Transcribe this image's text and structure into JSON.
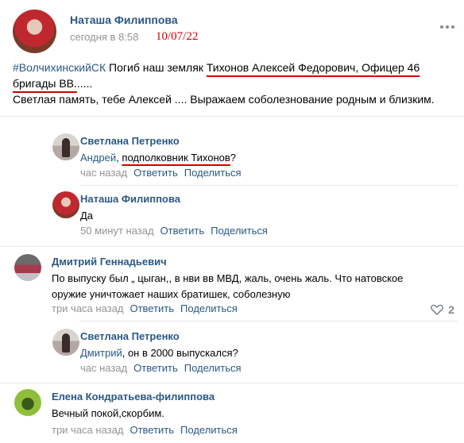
{
  "post": {
    "author": "Наташа Филиппова",
    "date": "сегодня в 8:58",
    "date_annotation": "10/07/22",
    "hashtag": "#ВолчихинскийСК",
    "text_1": " Погиб наш земляк ",
    "text_underlined_1": "Тихонов Алексей Федорович, Офицер 46",
    "text_underlined_2": "бригады ВВ.",
    "text_2": ".....",
    "text_3": "Светлая память, тебе Алексей .... Выражаем соболезнование родным и близким."
  },
  "actions": {
    "reply": "Ответить",
    "share": "Поделиться"
  },
  "comments": [
    {
      "author": "Светлана Петренко",
      "mention": "Андрей",
      "text_pre": ", ",
      "text_underlined": "подполковник Тихонов",
      "text_post": "?",
      "time": "час назад"
    },
    {
      "author": "Наташа Филиппова",
      "text": "Да",
      "time": "50 минут назад"
    },
    {
      "author": "Дмитрий Геннадьевич",
      "text_line1": "По выпуску был „ цыган,, в нви вв МВД, жаль, очень жаль. Что натовское",
      "text_line2": "оружие уничтожает наших братишек, соболезную",
      "time": "три часа назад",
      "likes": "2"
    },
    {
      "author": "Светлана Петренко",
      "mention": "Дмитрий",
      "text": ", он в 2000 выпускался?",
      "time": "час назад"
    },
    {
      "author": "Елена Кондратьева-филиппова",
      "text": "Вечный покой,скорбим.",
      "time": "три часа назад"
    }
  ]
}
